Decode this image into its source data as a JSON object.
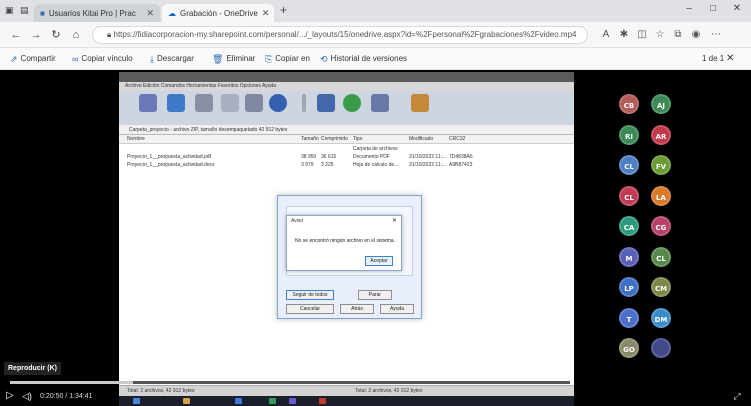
{
  "browser": {
    "tabs": [
      {
        "label": "Usuarios Kitai Pro | Prac",
        "active": false
      },
      {
        "label": "Grabación - OneDrive",
        "active": true
      }
    ],
    "new_tab": "+",
    "url": "https://fidiacorporacion-my.sharepoint.com/personal/.../_layouts/15/onedrive.aspx?id=%2Fpersonal%2Fgrabaciones%2Fvideo.mp4",
    "win_controls": {
      "minimize": "–",
      "maximize": "□",
      "close": "✕"
    }
  },
  "commands": [
    {
      "icon": "share-icon",
      "label": "Compartir"
    },
    {
      "icon": "link-icon",
      "label": "Copiar vínculo"
    },
    {
      "icon": "download-icon",
      "label": "Descargar"
    },
    {
      "icon": "delete-icon",
      "label": "Eliminar"
    },
    {
      "icon": "copy-icon",
      "label": "Copiar en"
    },
    {
      "icon": "history-icon",
      "label": "Historial de versiones"
    }
  ],
  "cmd_right": {
    "count": "1 de 1",
    "close": "✕"
  },
  "screen": {
    "menu": "Archivo  Edición  Comandos  Herramientas  Favoritos  Opciones  Ayuda",
    "path": "Carpeta_proyecto - archivo ZIP, tamaño desempaquetado 42 912 bytes",
    "columns": [
      "Nombre",
      "Tamaño",
      "Comprimido",
      "Tipo",
      "Modificado",
      "CRC32"
    ],
    "files": [
      {
        "name": "Proyecto_1__propuesta_actividad.pdf",
        "size": "38 950",
        "packed": "36 615",
        "type": "Documento PDF",
        "modified": "31/10/2022 11:...",
        "crc": "7D4838A6"
      },
      {
        "name": "Proyecto_1__propuesta_actividad.docx",
        "size": "3 979",
        "packed": "3 225",
        "type": "Hoja de cálculo de...",
        "modified": "31/10/2022 11:...",
        "crc": "A9B87423"
      }
    ],
    "parent_row": "Carpeta de archivos",
    "status_left": "Total: 2 archivos, 42 912 bytes",
    "status_right": "Total: 2 archivos, 42 912 bytes"
  },
  "dialogs": {
    "inner_title": "Aviso",
    "inner_message": "No se encontró ningún archivo en el sistema.",
    "inner_ok": "Aceptar",
    "outer_buttons": [
      "Seguir de todos",
      "Parar",
      "Cancelar",
      "Atrás",
      "Ayuda"
    ]
  },
  "participants": [
    {
      "initials": "CB",
      "color": "#b45a57"
    },
    {
      "initials": "AJ",
      "color": "#3b8a56"
    },
    {
      "initials": "RI",
      "color": "#3b8a56"
    },
    {
      "initials": "AR",
      "color": "#c4394a"
    },
    {
      "initials": "CL",
      "color": "#4f7ec4"
    },
    {
      "initials": "FV",
      "color": "#6b9a34"
    },
    {
      "initials": "CL",
      "color": "#c23b55"
    },
    {
      "initials": "LA",
      "color": "#d97a2a"
    },
    {
      "initials": "CA",
      "color": "#2d9a7f"
    },
    {
      "initials": "CG",
      "color": "#b8406a"
    },
    {
      "initials": "M",
      "color": "#5860b8"
    },
    {
      "initials": "CL",
      "color": "#57894c"
    },
    {
      "initials": "LP",
      "color": "#3f6fc2"
    },
    {
      "initials": "CM",
      "color": "#7d8748"
    },
    {
      "initials": "T",
      "color": "#4c6fcc"
    },
    {
      "initials": "DM",
      "color": "#3a8cc9"
    },
    {
      "initials": "GO",
      "color": "#8a8a6a"
    },
    {
      "initials": "",
      "color": "#404a8a"
    }
  ],
  "player": {
    "presenter": "Reproducir (K)",
    "time": "0:20:50 / 1:34:41",
    "progress_fraction": 0.22
  }
}
